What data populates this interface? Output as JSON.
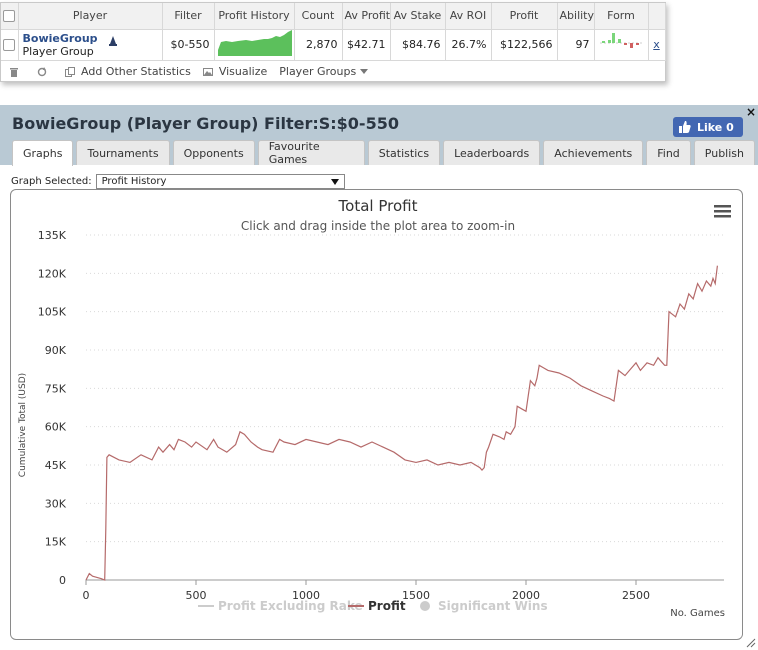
{
  "stats_table": {
    "headers": {
      "player": "Player",
      "filter": "Filter",
      "profit_history": "Profit History",
      "count": "Count",
      "av_profit": "Av Profit",
      "av_stake": "Av Stake",
      "av_roi": "Av ROI",
      "profit": "Profit",
      "ability": "Ability",
      "form": "Form"
    },
    "row": {
      "player_name": "BowieGroup",
      "player_type": "Player Group",
      "filter": "$0-550",
      "count": "2,870",
      "av_profit": "$42.71",
      "av_stake": "$84.76",
      "av_roi": "26.7%",
      "profit": "$122,566",
      "ability": "97",
      "remove": "x",
      "form_colors": [
        "#7bd67b",
        "#7bd67b",
        "#7bd67b",
        "#7bd67b",
        "#d06060",
        "#d06060"
      ]
    }
  },
  "toolbar": {
    "add_other_statistics": "Add Other Statistics",
    "visualize": "Visualize",
    "player_groups": "Player Groups"
  },
  "header": {
    "title": "BowieGroup (Player Group) Filter:S:$0-550",
    "like_label": "Like 0",
    "close_label": "×",
    "like_color": "#4267b2"
  },
  "tabs": [
    {
      "label": "Graphs",
      "active": true
    },
    {
      "label": "Tournaments",
      "active": false
    },
    {
      "label": "Opponents",
      "active": false
    },
    {
      "label": "Favourite Games",
      "active": false
    },
    {
      "label": "Statistics",
      "active": false
    },
    {
      "label": "Leaderboards",
      "active": false
    },
    {
      "label": "Achievements",
      "active": false
    },
    {
      "label": "Find",
      "active": false
    },
    {
      "label": "Publish",
      "active": false
    }
  ],
  "graph_select": {
    "label": "Graph Selected:",
    "value": "Profit History"
  },
  "chart_data": {
    "type": "line",
    "title": "Total Profit",
    "subtitle": "Click and drag inside the plot area to zoom-in",
    "xlabel": "No. Games",
    "ylabel": "Cumulative Total (USD)",
    "xlim": [
      0,
      2900
    ],
    "ylim": [
      0,
      135000
    ],
    "x_ticks": [
      0,
      500,
      1000,
      1500,
      2000,
      2500
    ],
    "y_ticks": [
      0,
      15000,
      30000,
      45000,
      60000,
      75000,
      90000,
      105000,
      120000,
      135000
    ],
    "y_tick_labels": [
      "0",
      "15K",
      "30K",
      "45K",
      "60K",
      "75K",
      "90K",
      "105K",
      "120K",
      "135K"
    ],
    "grid": true,
    "legend_position": "bottom-center",
    "legend": [
      {
        "name": "Profit Excluding Rake",
        "color": "#cccccc",
        "symbol": "line",
        "visible": false
      },
      {
        "name": "Profit",
        "color": "#b56a6a",
        "symbol": "line",
        "visible": true
      },
      {
        "name": "Significant Wins",
        "color": "#cccccc",
        "symbol": "circle",
        "visible": false
      }
    ],
    "series": [
      {
        "name": "Profit",
        "color": "#b56a6a",
        "x": [
          0,
          15,
          30,
          50,
          70,
          85,
          90,
          95,
          105,
          150,
          200,
          250,
          300,
          330,
          350,
          380,
          400,
          420,
          450,
          480,
          500,
          550,
          580,
          600,
          640,
          680,
          700,
          720,
          750,
          780,
          800,
          850,
          880,
          900,
          950,
          1000,
          1050,
          1100,
          1150,
          1200,
          1250,
          1300,
          1350,
          1400,
          1450,
          1500,
          1550,
          1600,
          1650,
          1700,
          1750,
          1790,
          1800,
          1810,
          1820,
          1830,
          1850,
          1880,
          1900,
          1910,
          1930,
          1950,
          1960,
          1980,
          2000,
          2020,
          2040,
          2050,
          2060,
          2080,
          2100,
          2150,
          2200,
          2250,
          2300,
          2350,
          2380,
          2400,
          2420,
          2450,
          2480,
          2500,
          2520,
          2550,
          2580,
          2600,
          2620,
          2630,
          2640,
          2650,
          2680,
          2700,
          2720,
          2740,
          2760,
          2770,
          2780,
          2800,
          2820,
          2840,
          2850,
          2860,
          2870
        ],
        "values": [
          0,
          2500,
          1500,
          1000,
          500,
          0,
          20000,
          48000,
          49000,
          47000,
          46000,
          49000,
          47000,
          52000,
          50000,
          53000,
          51000,
          55000,
          54000,
          52000,
          54000,
          51000,
          55000,
          52000,
          50000,
          53000,
          58000,
          57000,
          54000,
          52000,
          51000,
          50000,
          55000,
          54000,
          53000,
          55000,
          54000,
          53000,
          55000,
          54000,
          52000,
          54000,
          52000,
          50000,
          47000,
          46000,
          47000,
          45000,
          46000,
          45000,
          46000,
          44000,
          43000,
          44000,
          50000,
          52000,
          57000,
          56000,
          55000,
          58000,
          57000,
          60000,
          68000,
          67000,
          66000,
          78000,
          76000,
          79000,
          84000,
          83000,
          82000,
          81000,
          79000,
          76000,
          74000,
          72000,
          71000,
          70000,
          82000,
          80000,
          83000,
          85000,
          82000,
          85000,
          84000,
          87000,
          85000,
          84000,
          84000,
          105000,
          103000,
          108000,
          106000,
          112000,
          110000,
          113000,
          116000,
          113000,
          117000,
          115000,
          118000,
          116000,
          123000
        ]
      }
    ]
  }
}
